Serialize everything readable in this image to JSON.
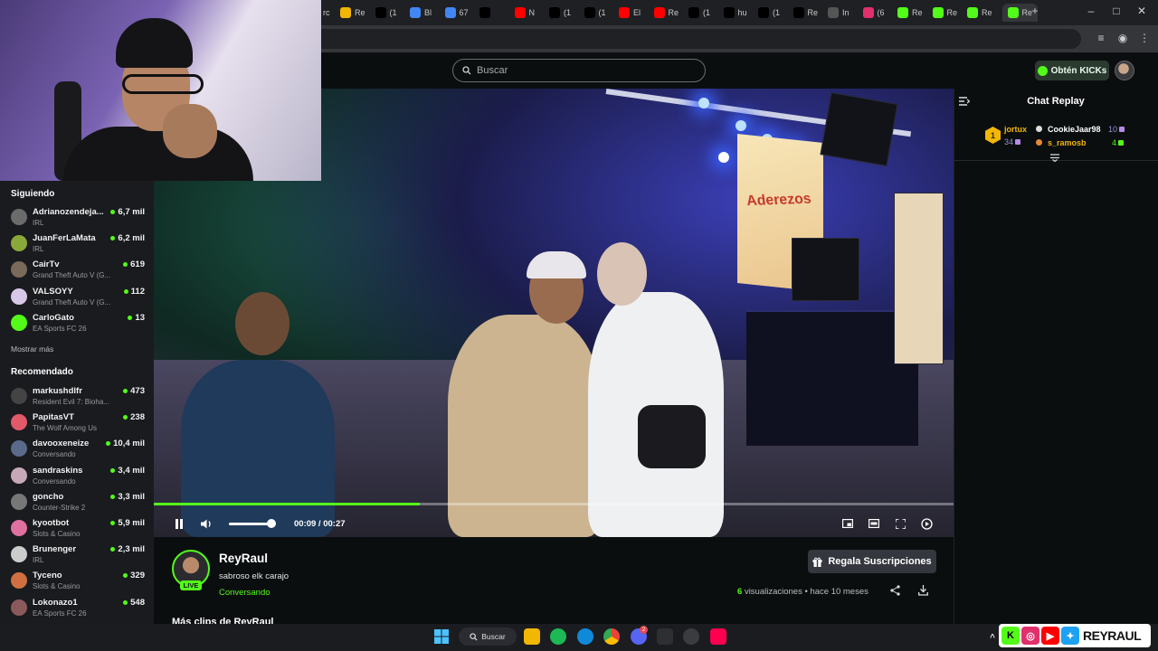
{
  "browser": {
    "tabs": [
      {
        "label": "Re",
        "color": "#f2b705"
      },
      {
        "label": "(1",
        "color": "#000000"
      },
      {
        "label": "Bl",
        "color": "#4285f4"
      },
      {
        "label": "67",
        "color": "#4285f4"
      },
      {
        "label": "",
        "color": "#000000"
      },
      {
        "label": "N",
        "color": "#ff0000"
      },
      {
        "label": "(1",
        "color": "#000000"
      },
      {
        "label": "(1",
        "color": "#000000"
      },
      {
        "label": "El",
        "color": "#ff0000"
      },
      {
        "label": "Re",
        "color": "#ff0000"
      },
      {
        "label": "(1",
        "color": "#000000"
      },
      {
        "label": "hu",
        "color": "#000000"
      },
      {
        "label": "(1",
        "color": "#000000"
      },
      {
        "label": "Re",
        "color": "#000000"
      },
      {
        "label": "In",
        "color": "#555555"
      },
      {
        "label": "(6",
        "color": "#e1306c"
      },
      {
        "label": "Re",
        "color": "#53fc18"
      },
      {
        "label": "Re",
        "color": "#53fc18"
      },
      {
        "label": "Re",
        "color": "#53fc18"
      },
      {
        "label": "Re",
        "color": "#53fc18"
      }
    ],
    "first_tab_fragment": "rc"
  },
  "header": {
    "search_placeholder": "Buscar",
    "kicks_button": "Obtén KICKs"
  },
  "sidebar": {
    "following_title": "Siguiendo",
    "following": [
      {
        "name": "Adrianozendeja...",
        "category": "IRL",
        "viewers": "6,7 mil",
        "avatar": "#6b6b6b"
      },
      {
        "name": "JuanFerLaMata",
        "category": "IRL",
        "viewers": "6,2 mil",
        "avatar": "#8aa83a"
      },
      {
        "name": "CairTv",
        "category": "Grand Theft Auto V (G...",
        "viewers": "619",
        "avatar": "#7a6a5a"
      },
      {
        "name": "VALSOYY",
        "category": "Grand Theft Auto V (G...",
        "viewers": "112",
        "avatar": "#d8c8e8"
      },
      {
        "name": "CarloGato",
        "category": "EA Sports FC 26",
        "viewers": "13",
        "avatar": "#53fc18"
      }
    ],
    "show_more": "Mostrar más",
    "recommended_title": "Recomendado",
    "recommended": [
      {
        "name": "markushdlfr",
        "category": "Resident Evil 7: Bioha...",
        "viewers": "473",
        "avatar": "#444444"
      },
      {
        "name": "PapitasVT",
        "category": "The Wolf Among Us",
        "viewers": "238",
        "avatar": "#e05a6a"
      },
      {
        "name": "davooxeneize",
        "category": "Conversando",
        "viewers": "10,4 mil",
        "avatar": "#5a6a8a"
      },
      {
        "name": "sandraskins",
        "category": "Conversando",
        "viewers": "3,4 mil",
        "avatar": "#c8a8b8"
      },
      {
        "name": "goncho",
        "category": "Counter-Strike 2",
        "viewers": "3,3 mil",
        "avatar": "#777777"
      },
      {
        "name": "kyootbot",
        "category": "Slots & Casino",
        "viewers": "5,9 mil",
        "avatar": "#e070a0"
      },
      {
        "name": "Brunenger",
        "category": "IRL",
        "viewers": "2,3 mil",
        "avatar": "#cccccc"
      },
      {
        "name": "Tyceno",
        "category": "Slots & Casino",
        "viewers": "329",
        "avatar": "#d07040"
      },
      {
        "name": "Lokonazo1",
        "category": "EA Sports FC 26",
        "viewers": "548",
        "avatar": "#8a5a5a"
      }
    ]
  },
  "player": {
    "time": "00:09 / 00:27",
    "progress": 0.333,
    "volume": 0.9,
    "video_text": "Aderezos"
  },
  "info": {
    "channel": "ReyRaul",
    "live_badge": "LIVE",
    "title": "sabroso elk carajo",
    "category": "Conversando",
    "views_count": "6",
    "views_label": "visualizaciones",
    "time_ago": "• hace 10 meses",
    "subs_button": "Regala Suscripciones",
    "more_clips": "Más clips de ReyRaul"
  },
  "chat": {
    "title": "Chat Replay",
    "gifters": [
      {
        "name": "jortux",
        "count": "34",
        "color": "#f2b705"
      },
      {
        "name": "CookieJaar98",
        "count": "10",
        "color": "#ffffff"
      },
      {
        "name": "s_ramosb",
        "count": "4",
        "color": "#f2b705"
      }
    ],
    "rank": "1"
  },
  "taskbar": {
    "search_label": "Buscar",
    "discord_badge": "2"
  },
  "socials": {
    "handle": "REYRAUL",
    "colors": {
      "kick": "#53fc18",
      "instagram": "#e1306c",
      "youtube": "#ff0000",
      "twitter": "#1da1f2"
    }
  },
  "colors": {
    "accent": "#53fc18",
    "background": "#0b0e0f",
    "sidebar": "#191b1f"
  }
}
